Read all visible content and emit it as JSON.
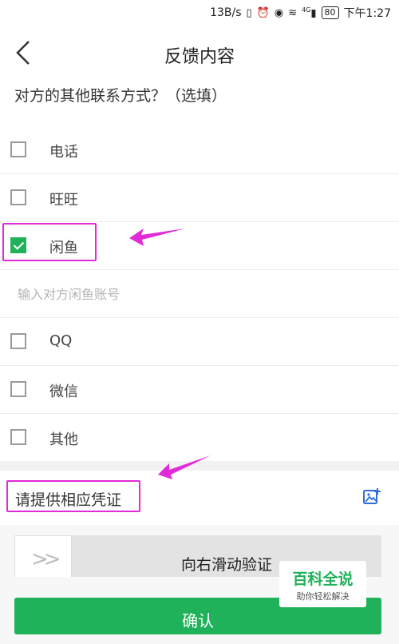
{
  "status_bar": {
    "speed": "13B/s",
    "signal": "4G",
    "battery": "80",
    "time": "下午1:27"
  },
  "header": {
    "title": "反馈内容"
  },
  "contact_section": {
    "title": "对方的其他联系方式？（选填）",
    "options": [
      {
        "label": "电话",
        "checked": false
      },
      {
        "label": "旺旺",
        "checked": false
      },
      {
        "label": "闲鱼",
        "checked": true
      },
      {
        "label": "QQ",
        "checked": false
      },
      {
        "label": "微信",
        "checked": false
      },
      {
        "label": "其他",
        "checked": false
      }
    ],
    "account_input": {
      "placeholder": "输入对方闲鱼账号",
      "value": ""
    }
  },
  "proof": {
    "label": "请提供相应凭证",
    "icon": "add-image-icon"
  },
  "slider": {
    "handle_symbol": ">>",
    "text": "向右滑动验证"
  },
  "confirm_button": {
    "label": "确认"
  },
  "watermark": {
    "main": "百科全说",
    "sub": "助你轻松解决"
  },
  "colors": {
    "accent": "#1fb25a",
    "annotation": "#e12ad8"
  }
}
